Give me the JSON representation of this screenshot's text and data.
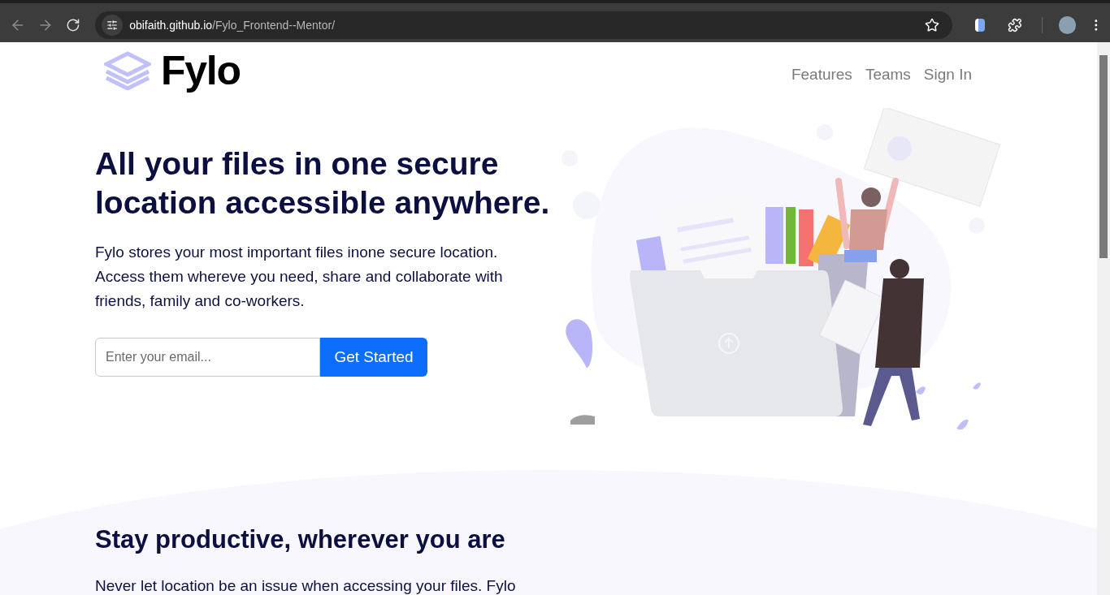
{
  "browser": {
    "url_host": "obifaith.github.io",
    "url_path": "/Fylo_Frontend--Mentor/"
  },
  "header": {
    "logo": "Fylo",
    "nav": [
      {
        "label": "Features"
      },
      {
        "label": "Teams"
      },
      {
        "label": "Sign In"
      }
    ]
  },
  "hero": {
    "title": "All your files in one secure location accessible anywhere.",
    "body": "Fylo stores your most important files inone secure location. Access them whereve you need, share and collaborate with friends, family and co-workers.",
    "email": {
      "placeholder": "Enter your email..."
    },
    "button": "Get Started"
  },
  "section": {
    "title": "Stay productive, wherever you are",
    "body": "Never let location be an issue when accessing your files. Fylo"
  }
}
